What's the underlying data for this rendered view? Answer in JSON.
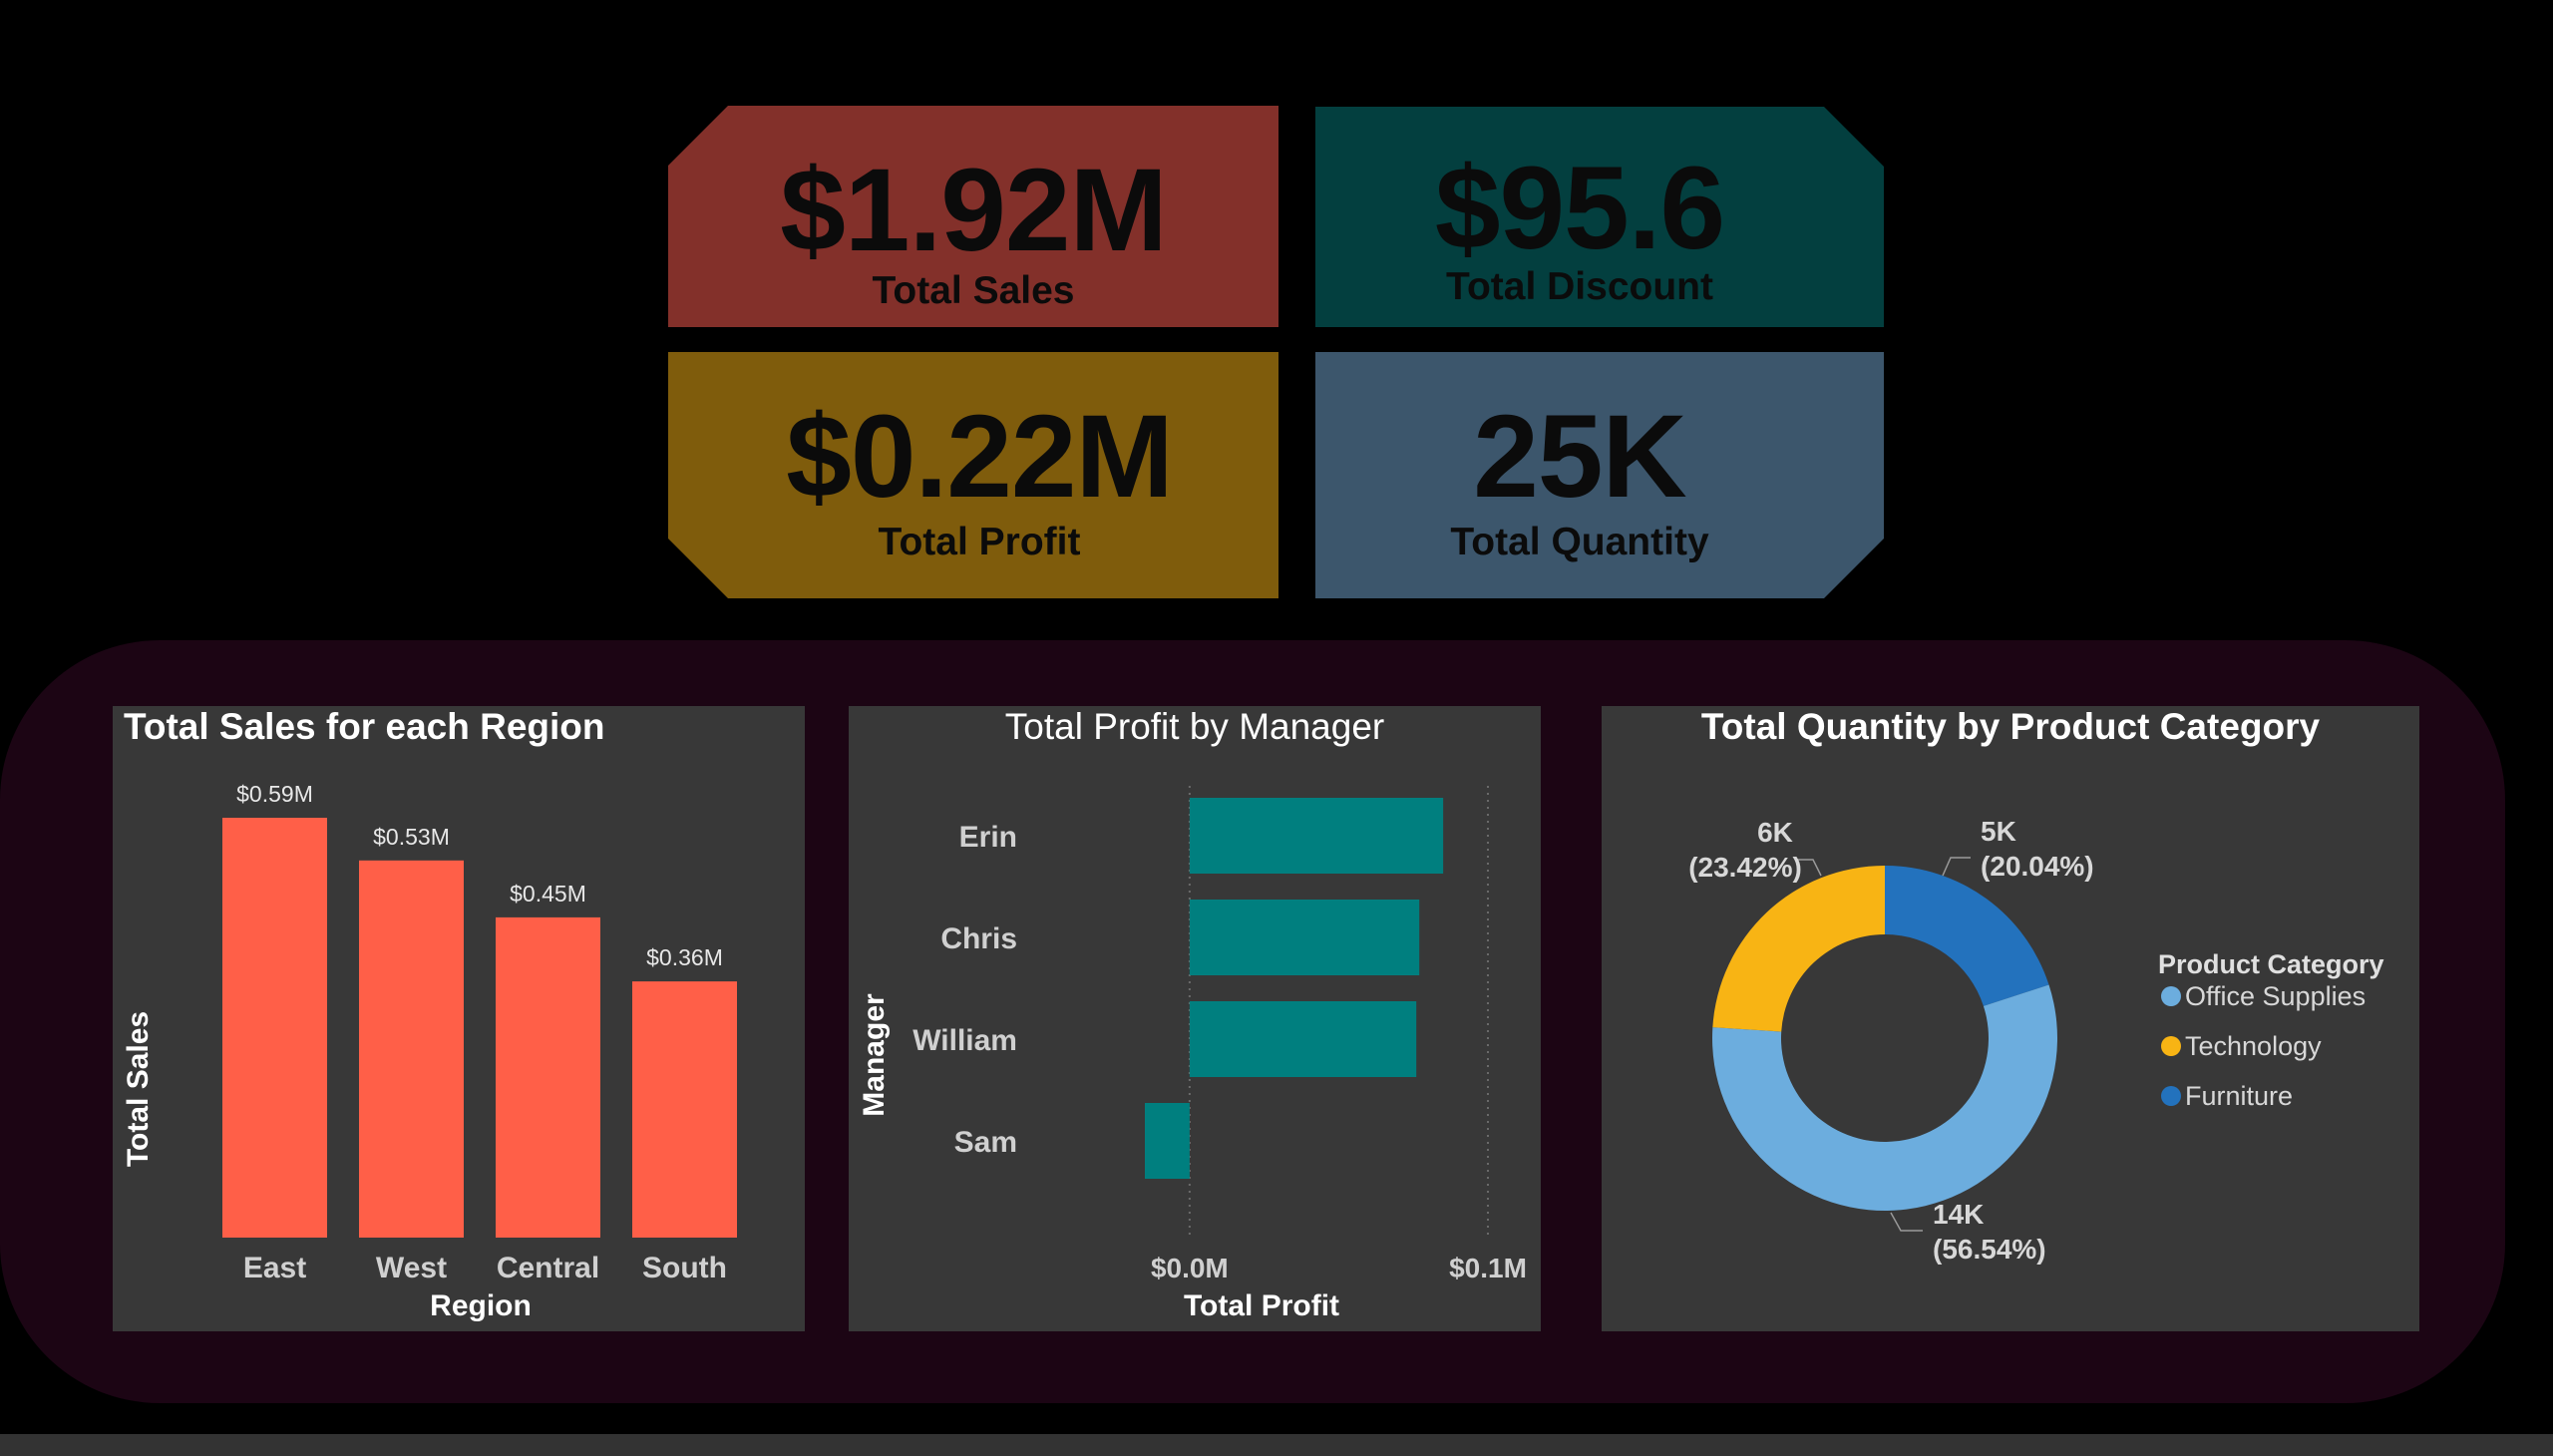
{
  "kpis": {
    "sales": {
      "value": "$1.92M",
      "label": "Total Sales"
    },
    "discount": {
      "value": "$95.6",
      "label": "Total Discount"
    },
    "profit": {
      "value": "$0.22M",
      "label": "Total Profit"
    },
    "quantity": {
      "value": "25K",
      "label": "Total Quantity"
    }
  },
  "colors": {
    "sales_card": "#83302a",
    "discount_card": "#033f3f",
    "profit_card": "#7f5c0c",
    "quantity_card": "#3c566c",
    "region_bar": "#ff5f48",
    "manager_bar": "#007f7f",
    "office_supplies": "#6cadde",
    "technology": "#f8b414",
    "furniture": "#2372bd"
  },
  "chart_data": [
    {
      "type": "bar",
      "title": "Total Sales for each Region",
      "xlabel": "Region",
      "ylabel": "Total Sales",
      "categories": [
        "East",
        "West",
        "Central",
        "South"
      ],
      "values": [
        0.59,
        0.53,
        0.45,
        0.36
      ],
      "data_labels": [
        "$0.59M",
        "$0.53M",
        "$0.45M",
        "$0.36M"
      ],
      "ylim": [
        0,
        0.59
      ],
      "grid": false
    },
    {
      "type": "bar",
      "orientation": "horizontal",
      "title": "Total Profit by Manager",
      "xlabel": "Total Profit",
      "ylabel": "Manager",
      "categories": [
        "Erin",
        "Chris",
        "William",
        "Sam"
      ],
      "values": [
        0.085,
        0.077,
        0.076,
        -0.015
      ],
      "x_ticks": [
        "$0.0M",
        "$0.1M"
      ],
      "xlim": [
        -0.016,
        0.1
      ],
      "grid": true
    },
    {
      "type": "pie",
      "subtype": "donut",
      "title": "Total Quantity by Product Category",
      "legend_title": "Product Category",
      "legend_position": "right",
      "categories": [
        "Office Supplies",
        "Technology",
        "Furniture"
      ],
      "values": [
        14,
        6,
        5
      ],
      "value_labels": [
        "14K",
        "6K",
        "5K"
      ],
      "percent_labels": [
        "(56.54%)",
        "(23.42%)",
        "(20.04%)"
      ],
      "percentages": [
        56.54,
        23.42,
        20.04
      ]
    }
  ]
}
